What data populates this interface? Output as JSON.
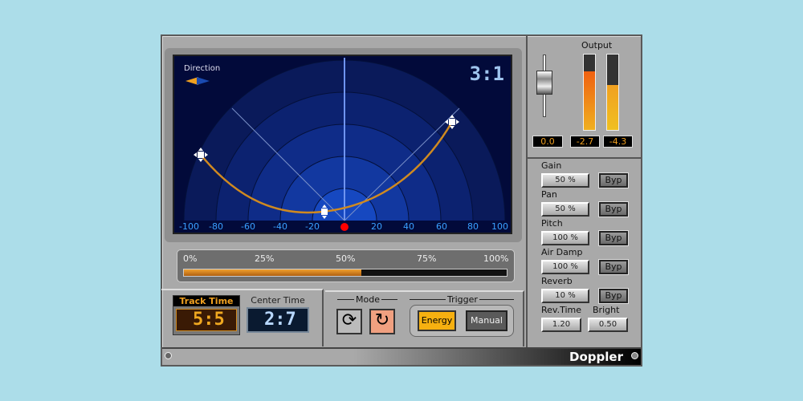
{
  "display": {
    "direction_label": "Direction",
    "counter": "3:1",
    "axis_ticks": [
      "-100",
      "-80",
      "-60",
      "-40",
      "-20",
      "20",
      "40",
      "60",
      "80",
      "100"
    ]
  },
  "progress": {
    "ticks": [
      "0%",
      "25%",
      "50%",
      "75%",
      "100%"
    ],
    "value_percent": 55
  },
  "track_time": {
    "label": "Track Time",
    "value": "5:5"
  },
  "center_time": {
    "label": "Center Time",
    "value": "2:7"
  },
  "mode": {
    "label": "Mode"
  },
  "trigger": {
    "label": "Trigger",
    "energy": "Energy",
    "manual": "Manual"
  },
  "output": {
    "label": "Output",
    "fader_value": "0.0",
    "left": "-2.7",
    "right": "-4.3",
    "left_level": 0.78,
    "right_level": 0.6
  },
  "params": [
    {
      "label": "Gain",
      "value": "50 %",
      "bypass": "Byp"
    },
    {
      "label": "Pan",
      "value": "50 %",
      "bypass": "Byp"
    },
    {
      "label": "Pitch",
      "value": "100 %",
      "bypass": "Byp"
    },
    {
      "label": "Air Damp",
      "value": "100 %",
      "bypass": "Byp"
    },
    {
      "label": "Reverb",
      "value": "10 %",
      "bypass": "Byp"
    }
  ],
  "rev_time": {
    "label": "Rev.Time",
    "value": "1.20"
  },
  "bright": {
    "label": "Bright",
    "value": "0.50"
  },
  "brand": "Doppler",
  "colors": {
    "accent": "#f0a020",
    "background": "#acdde9"
  }
}
